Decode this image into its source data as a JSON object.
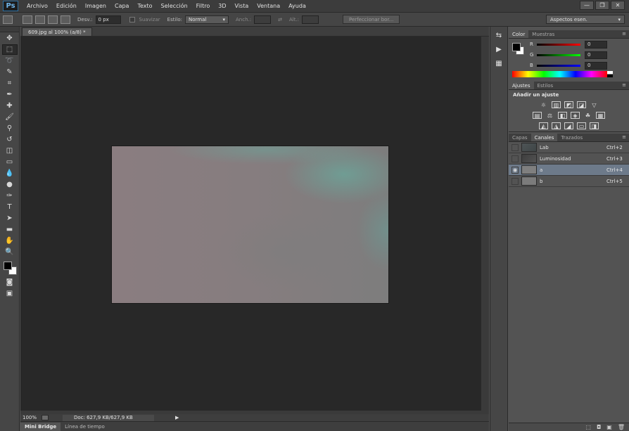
{
  "app": {
    "logo": "Ps"
  },
  "menu": [
    "Archivo",
    "Edición",
    "Imagen",
    "Capa",
    "Texto",
    "Selección",
    "Filtro",
    "3D",
    "Vista",
    "Ventana",
    "Ayuda"
  ],
  "window_controls": [
    "—",
    "❐",
    "✕"
  ],
  "options": {
    "feather_label": "Desv.:",
    "feather_value": "0 px",
    "smooth_label": "Suavizar",
    "style_label": "Estilo:",
    "style_value": "Normal",
    "width_label": "Anch.:",
    "height_label": "Alt.:",
    "refine_button": "Perfeccionar bor...",
    "workspace": "Aspectos esen."
  },
  "document": {
    "tab_title": "609.jpg al 100% (a/8) *",
    "zoom": "100%",
    "doc_info": "Doc: 627,9 KB/627,9 KB"
  },
  "bottom_tabs": [
    "Mini Bridge",
    "Línea de tiempo"
  ],
  "color_panel": {
    "tabs": [
      "Color",
      "Muestras"
    ],
    "sliders": [
      {
        "label": "R",
        "value": "0",
        "gradient": "linear-gradient(90deg,#000,#ff0000)"
      },
      {
        "label": "G",
        "value": "0",
        "gradient": "linear-gradient(90deg,#000,#00ff00)"
      },
      {
        "label": "B",
        "value": "0",
        "gradient": "linear-gradient(90deg,#000,#0000ff)"
      }
    ]
  },
  "adjustments_panel": {
    "tabs": [
      "Ajustes",
      "Estilos"
    ],
    "title": "Añadir un ajuste"
  },
  "channels_panel": {
    "tabs": [
      "Capas",
      "Canales",
      "Trazados"
    ],
    "channels": [
      {
        "name": "Lab",
        "shortcut": "Ctrl+2",
        "selected": false
      },
      {
        "name": "Luminosidad",
        "shortcut": "Ctrl+3",
        "selected": false
      },
      {
        "name": "a",
        "shortcut": "Ctrl+4",
        "selected": true
      },
      {
        "name": "b",
        "shortcut": "Ctrl+5",
        "selected": false
      }
    ]
  }
}
